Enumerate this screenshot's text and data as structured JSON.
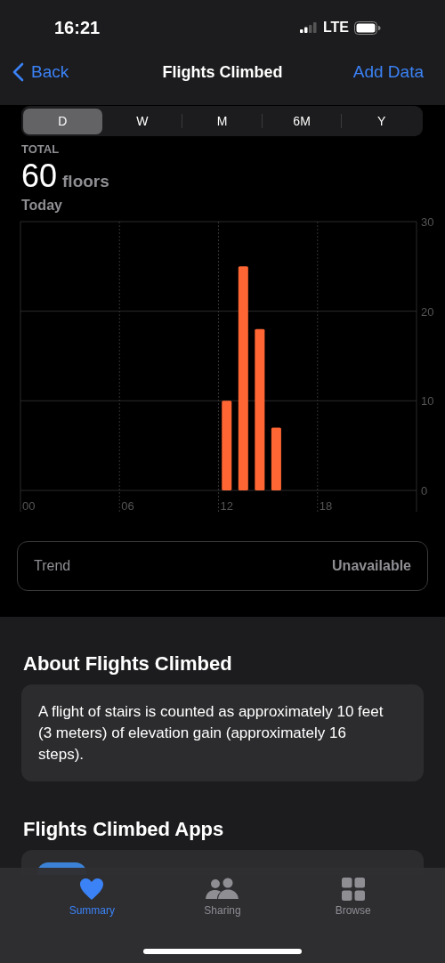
{
  "status_bar": {
    "time": "16:21",
    "network": "LTE"
  },
  "nav": {
    "back": "Back",
    "title": "Flights Climbed",
    "action": "Add Data"
  },
  "segments": [
    {
      "label": "D",
      "selected": true
    },
    {
      "label": "W",
      "selected": false
    },
    {
      "label": "M",
      "selected": false
    },
    {
      "label": "6M",
      "selected": false
    },
    {
      "label": "Y",
      "selected": false
    }
  ],
  "summary": {
    "label": "TOTAL",
    "value": "60",
    "unit": "floors",
    "period": "Today"
  },
  "chart_data": {
    "type": "bar",
    "x": [
      12,
      13,
      14,
      15
    ],
    "series": [
      {
        "color": "#ff6633",
        "values": [
          10,
          25,
          18,
          7
        ]
      }
    ],
    "xlim": [
      -0.5,
      23.5
    ],
    "ylim": [
      0,
      30
    ],
    "yticks": [
      0,
      10,
      20,
      30
    ],
    "xticks": [
      {
        "value": 0,
        "label": "00"
      },
      {
        "value": 6,
        "label": "06"
      },
      {
        "value": 12,
        "label": "12"
      },
      {
        "value": 18,
        "label": "18"
      }
    ]
  },
  "trend": {
    "label": "Trend",
    "value": "Unavailable"
  },
  "about": {
    "title": "About Flights Climbed",
    "text": "A flight of stairs is counted as approximately 10 feet (3 meters) of elevation gain (approximately 16 steps)."
  },
  "apps": {
    "title": "Flights Climbed Apps"
  },
  "tab_bar": [
    {
      "label": "Summary",
      "kind": "heart",
      "selected": true
    },
    {
      "label": "Sharing",
      "kind": "people",
      "selected": false
    },
    {
      "label": "Browse",
      "kind": "grid",
      "selected": false
    }
  ]
}
